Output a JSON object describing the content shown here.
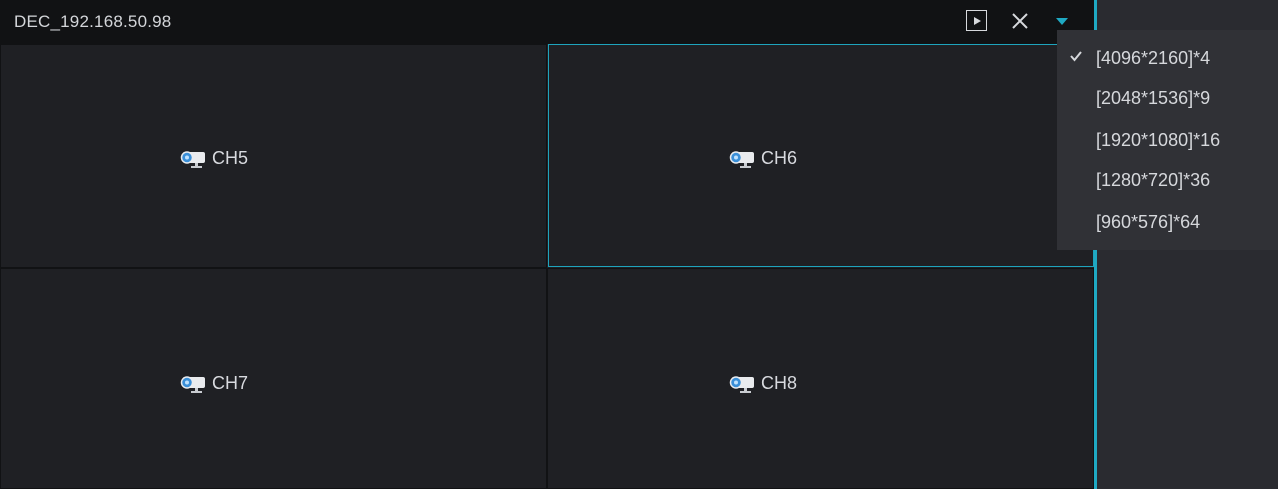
{
  "window": {
    "title": "DEC_192.168.50.98"
  },
  "toolbar": {
    "play_icon": "play-icon",
    "close_icon": "close-icon",
    "dropdown_icon": "triangle-down-icon"
  },
  "channels": [
    {
      "label": "CH5",
      "icon": "camera-icon",
      "selected": false
    },
    {
      "label": "CH6",
      "icon": "camera-icon",
      "selected": true
    },
    {
      "label": "CH7",
      "icon": "camera-icon",
      "selected": false
    },
    {
      "label": "CH8",
      "icon": "camera-icon",
      "selected": false
    }
  ],
  "resolution_menu": {
    "items": [
      {
        "label": "[4096*2160]*4",
        "checked": true
      },
      {
        "label": "[2048*1536]*9",
        "checked": false
      },
      {
        "label": "[1920*1080]*16",
        "checked": false
      },
      {
        "label": "[1280*720]*36",
        "checked": false
      },
      {
        "label": "[960*576]*64",
        "checked": false
      }
    ]
  },
  "colors": {
    "accent": "#1fa9c3",
    "titlebar": "#111214",
    "cell_bg": "#1f2024",
    "menu_bg": "#303136"
  }
}
